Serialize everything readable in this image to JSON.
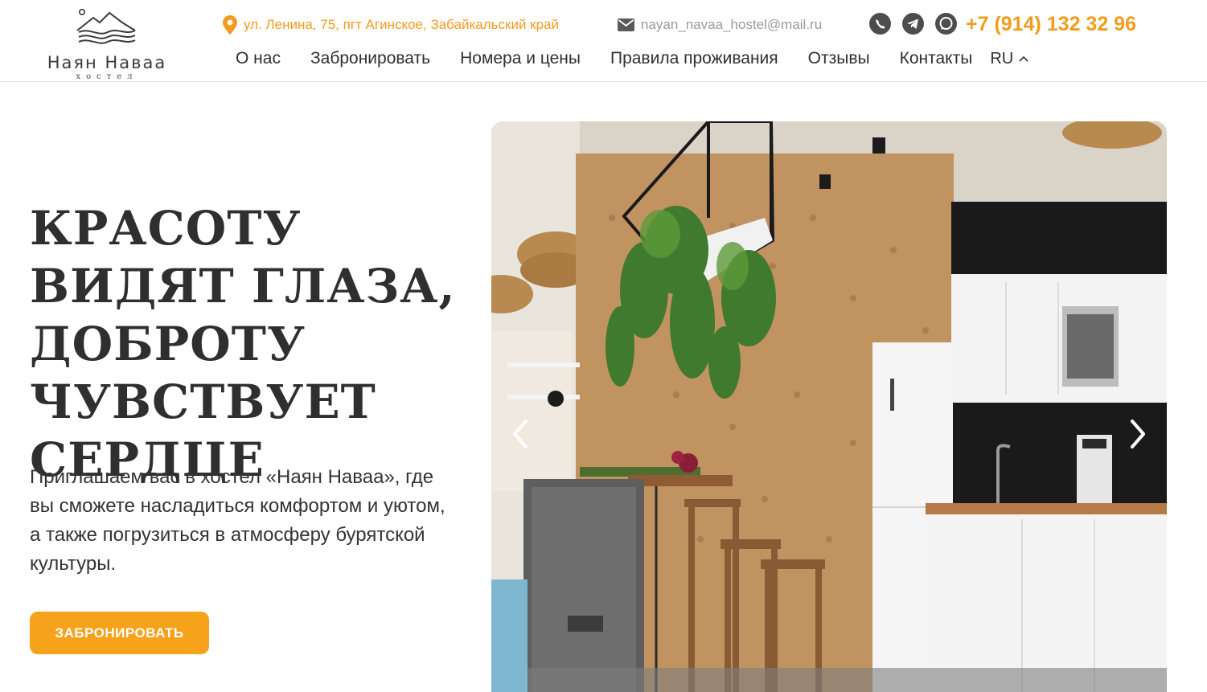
{
  "brand": {
    "name": "Наян Наваа",
    "subtitle": "хостел"
  },
  "contacts": {
    "address": "ул. Ленина, 75, пгт Агинское, Забайкальский край",
    "email": "nayan_navaa_hostel@mail.ru",
    "phone": "+7 (914) 132 32 96",
    "socials": [
      "viber-icon",
      "telegram-icon",
      "whatsapp-icon"
    ]
  },
  "nav": {
    "items": [
      {
        "label": "О нас"
      },
      {
        "label": "Забронировать"
      },
      {
        "label": "Номера и цены"
      },
      {
        "label": "Правила проживания"
      },
      {
        "label": "Отзывы"
      },
      {
        "label": "Контакты"
      }
    ],
    "language": "RU"
  },
  "hero": {
    "title": "Красоту видят глаза, доброту чувствует сердце",
    "text": "Приглашаем вас в хостел «Наян Наваа», где вы сможете насладиться комфортом  и уютом, а также погрузиться в атмосферу бурятской культуры.",
    "cta_label": "ЗАБРОНИРОВАТЬ"
  },
  "colors": {
    "accent": "#f7a21b",
    "accent_text": "#f29b1d",
    "text": "#2f2f2f",
    "muted": "#9a9a9a"
  }
}
